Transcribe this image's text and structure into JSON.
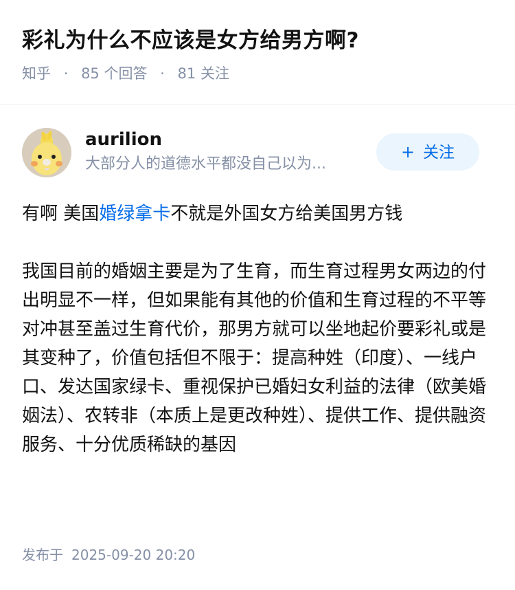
{
  "question": {
    "title": "彩礼为什么不应该是女方给男方啊?",
    "source": "知乎",
    "separator": "·",
    "answer_count": "85",
    "answer_count_label": "个回答",
    "follower_count": "81",
    "follower_count_label": "关注"
  },
  "author": {
    "name": "aurilion",
    "bio": "大部分人的道德水平都没自己以为...",
    "avatar_icon": "yellow-bird-avatar",
    "follow_plus": "+",
    "follow_label": "关注"
  },
  "answer": {
    "paragraph1_prefix": "有啊 美国",
    "paragraph1_link": "婚绿拿卡",
    "paragraph1_suffix": "不就是外国女方给美国男方钱",
    "paragraph2": "我国目前的婚姻主要是为了生育，而生育过程男女两边的付出明显不一样，但如果能有其他的价值和生育过程的不平等对冲甚至盖过生育代价，那男方就可以坐地起价要彩礼或是其变种了，价值包括但不限于：提高种姓（印度）、一线户口、发达国家绿卡、重视保护已婚妇女利益的法律（欧美婚姻法）、农转非（本质上是更改种姓）、提供工作、提供融资服务、十分优质稀缺的基因"
  },
  "publish": {
    "label": "发布于",
    "time": "2025-09-20 20:20"
  },
  "colors": {
    "text": "#121212",
    "meta": "#8590a6",
    "link": "#056de8",
    "follow_bg": "#ebf5fd"
  }
}
